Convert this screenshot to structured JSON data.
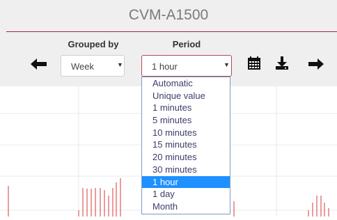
{
  "header": {
    "title": "CVM-A1500"
  },
  "toolbar": {
    "grouped_by_label": "Grouped by",
    "grouped_by_value": "Week",
    "period_label": "Period",
    "period_value": "1 hour",
    "prev_icon": "arrow-left-icon",
    "calendar_icon": "calendar-icon",
    "download_icon": "download-icon",
    "next_icon": "arrow-right-icon"
  },
  "period_dropdown": {
    "options": [
      "Automatic",
      "Unique value",
      "1 minutes",
      "5 minutes",
      "10 minutes",
      "15 minutes",
      "20 minutes",
      "30 minutes",
      "1 hour",
      "1 day",
      "Month"
    ],
    "selected_index": 8
  },
  "colors": {
    "accent_line": "#a9213a",
    "bar_color": "#e06666",
    "selected_option_bg": "#1e90ff"
  }
}
